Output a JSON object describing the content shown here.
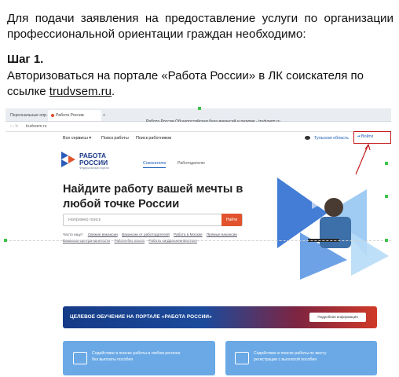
{
  "instructions": {
    "intro": "Для подачи заявления на предоставление услуги по организации профессиональной ориентации граждан необходимо:",
    "step_title": "Шаг 1.",
    "step_text_before": "Авторизоваться на портале «Работа России» в ЛК соискателя по ссылке ",
    "step_link": "trudvsem.ru",
    "step_text_after": "."
  },
  "browser": {
    "tabs": [
      "Персональные опр...",
      "Работа России",
      "+"
    ],
    "address": "trudvsem.ru",
    "page_title": "Работа России Общероссийская база вакансий и резюме - trudvsem.ru"
  },
  "site": {
    "nav": {
      "all_services": "Все сервисы ▾",
      "find_jobs": "Поиск работы",
      "find_workers": "Поиск работников",
      "region": "Тульская область",
      "login": "Войти"
    },
    "logo": {
      "line1": "РАБОТА",
      "line2": "РОССИИ",
      "sub": "Федеральный портал"
    },
    "roles": {
      "seekers": "Соискателю",
      "employers": "Работодателю"
    },
    "hero_title": "Найдите работу вашей мечты в любой точке России",
    "search": {
      "placeholder": "Например поиск",
      "button": "Найти"
    },
    "quick_links": {
      "label": "Часто ищут:",
      "items": [
        "Свежие вакансии",
        "Вакансии от работодателей",
        "Работа в Москве",
        "Прямые вакансии",
        "Вакансии центра занятости",
        "Работа без опыта",
        "Работа на Дальнем Востоке"
      ]
    },
    "banner": {
      "text": "ЦЕЛЕВОЕ ОБУЧЕНИЕ НА ПОРТАЛЕ «РАБОТА РОССИИ»",
      "button": "Подробная информация"
    },
    "cards": [
      {
        "text": "Содействие в поиске работы в любом регионе без выплаты пособия"
      },
      {
        "text": "Содействие в поиске работы по месту регистрации с выплатой пособия"
      }
    ]
  },
  "colors": {
    "accent_red": "#e2532d",
    "brand_blue": "#1c3a8a",
    "card_blue": "#6aa9e6",
    "highlight_red": "#c51d1d"
  }
}
